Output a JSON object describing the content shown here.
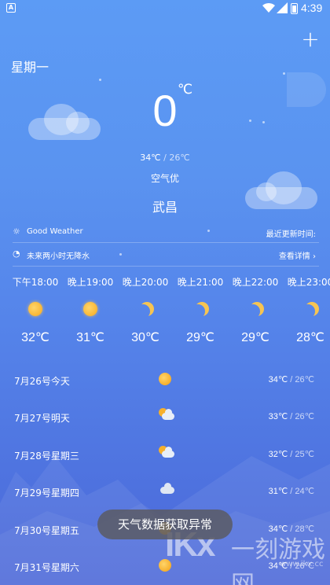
{
  "status_bar": {
    "app_icon_letter": "A",
    "time": "4:39"
  },
  "header": {
    "add_symbol": "+",
    "weekday": "星期一"
  },
  "current": {
    "temperature": "0",
    "unit": "℃",
    "high": "34℃",
    "separator": " / ",
    "low": "26℃",
    "air_quality": "空气优",
    "city": "武昌"
  },
  "info": {
    "weather_text": "Good Weather",
    "update_label": "最近更新时间:",
    "rain_text": "未来两小时无降水",
    "details_link": "查看详情",
    "details_chevron": "›"
  },
  "hourly": [
    {
      "time": "下午18:00",
      "icon": "sun-icon",
      "temp": "32℃"
    },
    {
      "time": "晚上19:00",
      "icon": "sun-icon",
      "temp": "31℃"
    },
    {
      "time": "晚上20:00",
      "icon": "moon-icon",
      "temp": "30℃"
    },
    {
      "time": "晚上21:00",
      "icon": "moon-icon",
      "temp": "29℃"
    },
    {
      "time": "晚上22:00",
      "icon": "moon-icon",
      "temp": "29℃"
    },
    {
      "time": "晚上23:00",
      "icon": "moon-icon",
      "temp": "28℃"
    }
  ],
  "daily": [
    {
      "date": "7月26号今天",
      "icon": "sun-icon",
      "high": "34℃",
      "sep": " / ",
      "low": "26℃"
    },
    {
      "date": "7月27号明天",
      "icon": "partly-cloudy-icon",
      "high": "33℃",
      "sep": " / ",
      "low": "26℃"
    },
    {
      "date": "7月28号星期三",
      "icon": "partly-cloudy-icon",
      "high": "32℃",
      "sep": " / ",
      "low": "25℃"
    },
    {
      "date": "7月29号星期四",
      "icon": "cloudy-icon",
      "high": "31℃",
      "sep": " / ",
      "low": "24℃"
    },
    {
      "date": "7月30号星期五",
      "icon": "sun-icon",
      "high": "34℃",
      "sep": " / ",
      "low": "28℃"
    },
    {
      "date": "7月31号星期六",
      "icon": "sun-icon",
      "high": "34℃",
      "sep": " / ",
      "low": "26℃"
    }
  ],
  "toast": {
    "message": "天气数据获取异常"
  },
  "watermark": {
    "logo": "IKx",
    "text": "一刻游戏网",
    "url": "www.ikx.cc"
  }
}
